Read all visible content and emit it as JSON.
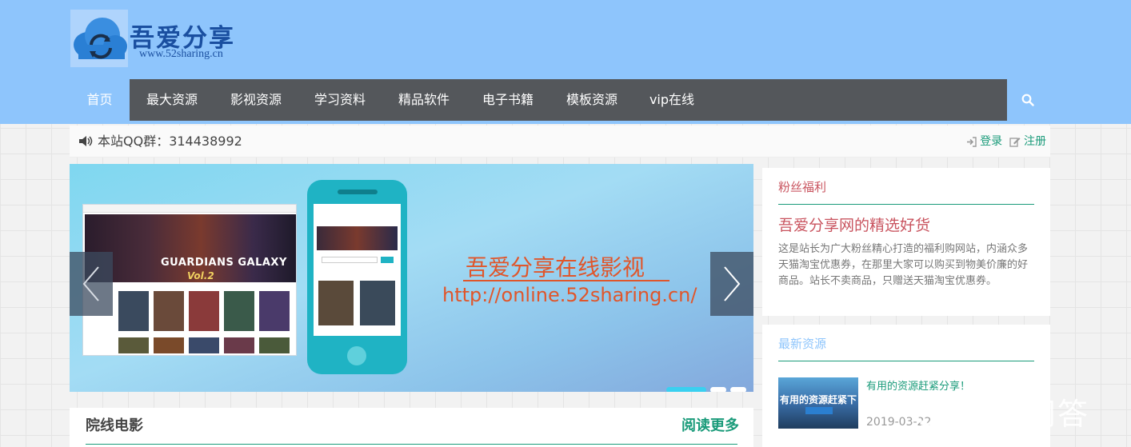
{
  "colors": {
    "header_bg": "#8ec5fc",
    "nav_bg": "#54575b",
    "accent_green": "#1a9b7a",
    "accent_red": "#c9545f",
    "slide_text": "#e0562b"
  },
  "logo": {
    "title": "吾爱分享",
    "url": "www.52sharing.cn",
    "icon": "cloud-refresh-icon"
  },
  "nav": {
    "items": [
      "首页",
      "最大资源",
      "影视资源",
      "学习资料",
      "精品软件",
      "电子书籍",
      "模板资源",
      "vip在线"
    ],
    "active": "首页",
    "search_icon": "search-icon"
  },
  "notice": {
    "text": "本站QQ群：314438992",
    "login": "登录",
    "register": "注册"
  },
  "slider": {
    "title": "吾爱分享在线影视",
    "url": "http://online.52sharing.cn/",
    "mock_movie": "GUARDIANS GALAXY",
    "mock_movie_sub": "Vol.2",
    "active_dot": 0,
    "dot_count": 3
  },
  "fans": {
    "title": "粉丝福利",
    "headline": "吾爱分享网的精选好货",
    "desc": "这是站长为广大粉丝精心打造的福利购网站，内涵众多天猫淘宝优惠券，在那里大家可以购买到物美价廉的好商品。站长不卖商品，只赠送天猫淘宝优惠券。"
  },
  "latest": {
    "title": "最新资源",
    "item_title": "有用的资源赶紧分享！",
    "item_thumb_text": "有用的资源赶紧下",
    "item_date": "2019-03-22"
  },
  "movies": {
    "title": "院线电影",
    "more": "阅读更多"
  },
  "watermark": {
    "text": "悟空问答"
  }
}
